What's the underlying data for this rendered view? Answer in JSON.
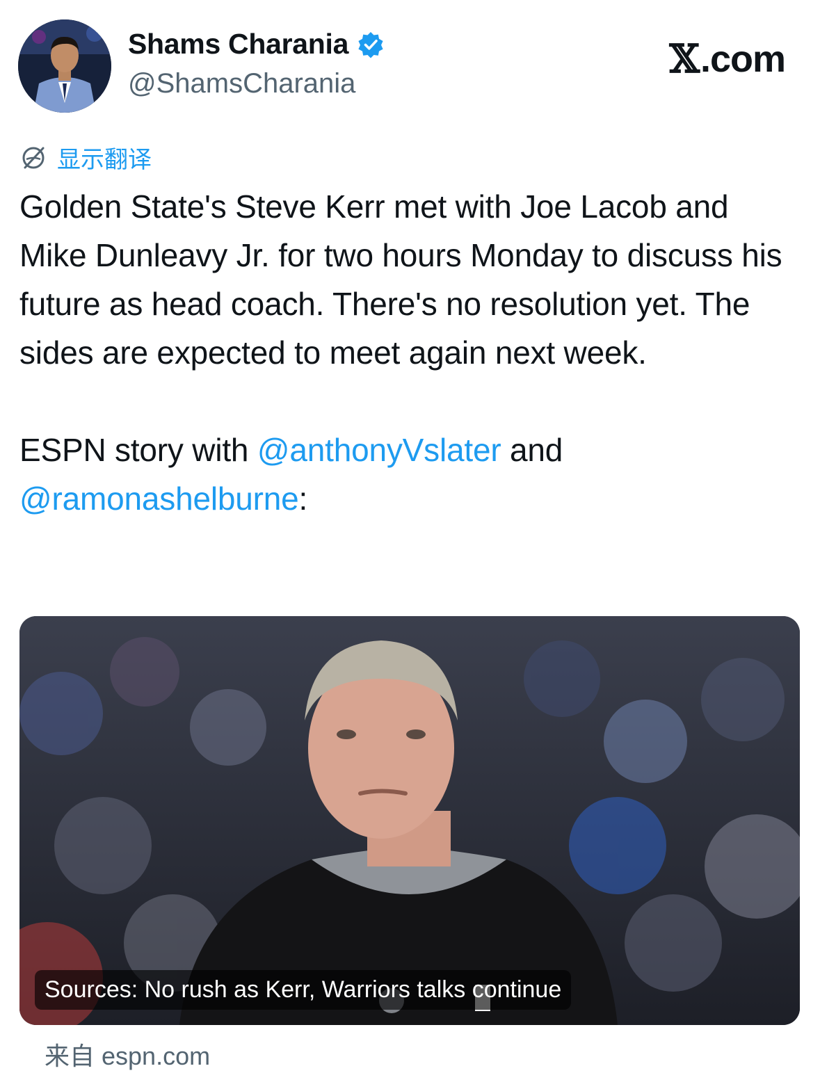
{
  "author": {
    "name": "Shams Charania",
    "handle": "@ShamsCharania",
    "verified": true,
    "avatar_icon": "avatar"
  },
  "brand": {
    "x_glyph": "𝕏",
    "domain": ".com"
  },
  "translate": {
    "label": "显示翻译",
    "icon": "globe-off-icon"
  },
  "tweet": {
    "paragraph1": "Golden State's Steve Kerr met with Joe Lacob and Mike Dunleavy Jr. for two hours Monday to discuss his future as head coach. There's no resolution yet. The sides are expected to meet again next week.",
    "p2_prefix": "ESPN story with ",
    "mention1": "@anthonyVslater",
    "p2_middle": " and ",
    "mention2": "@ramonashelburne",
    "p2_suffix": ":"
  },
  "link_card": {
    "title": "Sources: No rush as Kerr, Warriors talks continue"
  },
  "source": {
    "label": "来自 espn.com"
  },
  "colors": {
    "accent": "#1d9bf0",
    "secondary_text": "#536471",
    "text": "#0f1419"
  }
}
